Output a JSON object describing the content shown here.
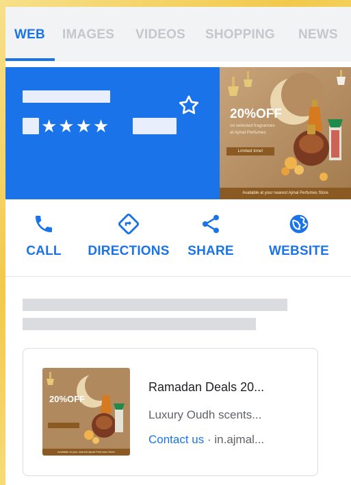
{
  "tabs": [
    {
      "label": "WEB",
      "active": true
    },
    {
      "label": "IMAGES",
      "active": false
    },
    {
      "label": "VIDEOS",
      "active": false
    },
    {
      "label": "SHOPPING",
      "active": false
    },
    {
      "label": "NEWS",
      "active": false
    }
  ],
  "hero": {
    "rating_stars": "★★★★",
    "favorite_icon": "star-outline-icon",
    "ad": {
      "headline": "20%OFF",
      "sub_line_1": "on selected fragrances",
      "sub_line_2": "at Ajmal Perfumes",
      "button": "Limited time!",
      "footer": "Available at your nearest Ajmal Perfumes Store"
    }
  },
  "actions": [
    {
      "label": "CALL",
      "icon": "phone-icon"
    },
    {
      "label": "DIRECTIONS",
      "icon": "directions-icon"
    },
    {
      "label": "SHARE",
      "icon": "share-icon"
    },
    {
      "label": "WEBSITE",
      "icon": "globe-icon"
    }
  ],
  "result": {
    "thumbnail": {
      "headline": "20%OFF",
      "footer": "Available at your nearest Ajmal Perfumes Store"
    },
    "title": "Ramadan Deals 20...",
    "description": "Luxury Oudh scents...",
    "link_text": "Contact us",
    "separator": " · ",
    "domain": "in.ajmal..."
  },
  "colors": {
    "accent": "#1a73e8",
    "tab_inactive": "#c4c7cb",
    "placeholder": "#dadce0",
    "background_gold": "#f2c94c"
  }
}
